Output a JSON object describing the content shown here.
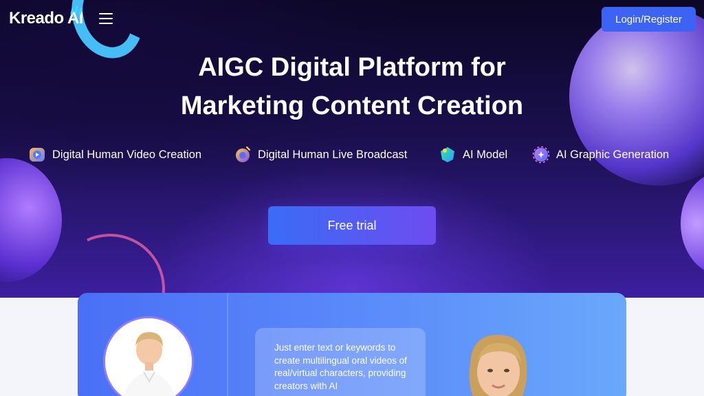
{
  "brand": {
    "logo_text": "Kreado AI"
  },
  "header": {
    "login_label": "Login/Register"
  },
  "hero": {
    "headline_line1": "AIGC Digital Platform for",
    "headline_line2": "Marketing Content Creation",
    "cta_label": "Free trial"
  },
  "features": [
    {
      "label": "Digital Human Video Creation",
      "icon": "video-creation-icon"
    },
    {
      "label": "Digital Human Live Broadcast",
      "icon": "live-broadcast-icon"
    },
    {
      "label": "AI Model",
      "icon": "ai-model-icon"
    },
    {
      "label": "AI Graphic Generation",
      "icon": "graphic-generation-icon"
    }
  ],
  "demo": {
    "description": "Just enter text or keywords to create multilingual oral videos of real/virtual characters, providing creators with AI"
  },
  "colors": {
    "primary_blue": "#3d63f5",
    "hero_dark": "#0b0724",
    "hero_purple": "#3b1f9e",
    "lower_bg": "#f3f5fb"
  }
}
